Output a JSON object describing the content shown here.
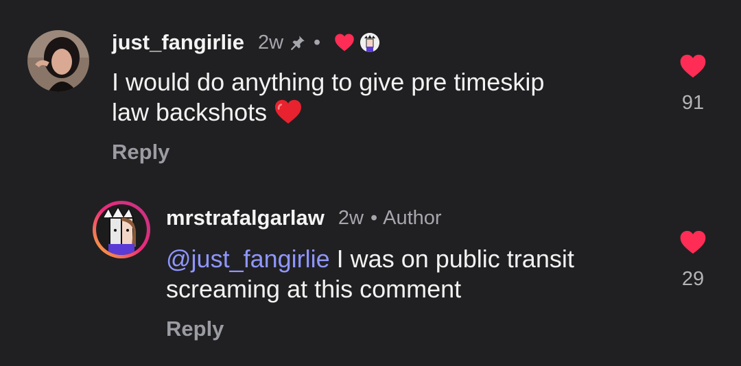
{
  "comments": [
    {
      "username": "just_fangirlie",
      "age": "2w",
      "dot": "•",
      "text": "I would do anything to give pre timeskip law backshots ❤️",
      "text_line1": "I would do anything to give pre timeskip",
      "text_line2": "law backshots",
      "emoji": "❤️",
      "reply_label": "Reply",
      "likes": "91",
      "pinned": true,
      "liked_by_author": true
    },
    {
      "username": "mrstrafalgarlaw",
      "age": "2w",
      "dot": "•",
      "author_label": "Author",
      "mention": "@just_fangirlie",
      "text_line1_rest": " I was on public transit",
      "text_line2": "screaming at this comment",
      "reply_label": "Reply",
      "likes": "29"
    }
  ],
  "colors": {
    "background": "#202022",
    "heart": "#ff2d55",
    "mention": "#8f96ff",
    "story_ring_start": "#f9b934",
    "story_ring_end": "#c13584"
  },
  "icons": [
    "pin-icon",
    "heart-icon",
    "author-avatar-icon"
  ]
}
